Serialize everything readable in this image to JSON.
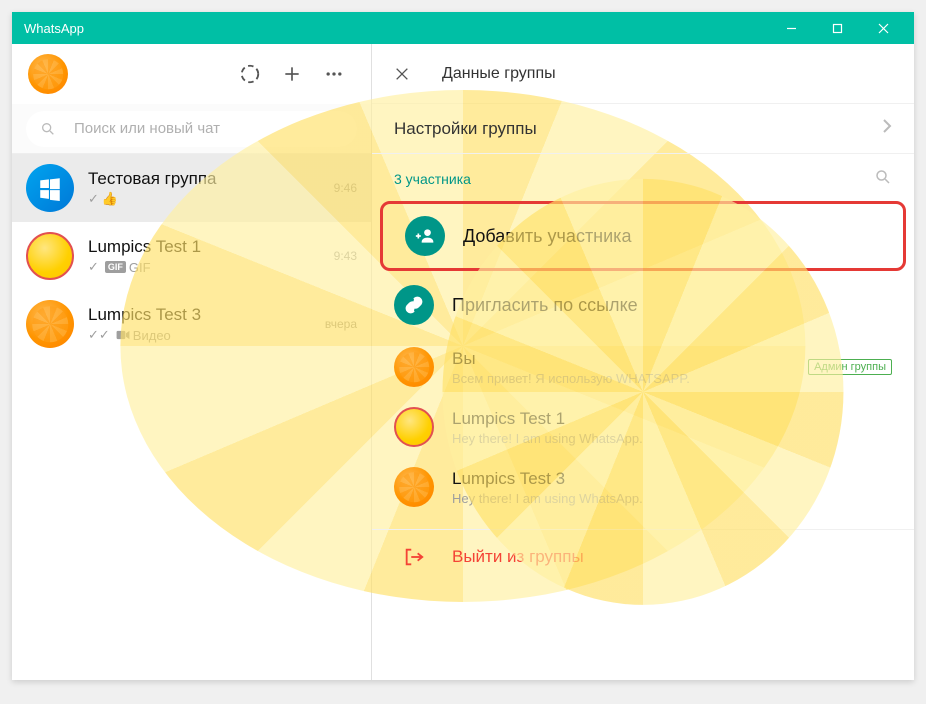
{
  "titlebar": {
    "title": "WhatsApp"
  },
  "search": {
    "placeholder": "Поиск или новый чат"
  },
  "chats": [
    {
      "title": "Тестовая группа",
      "sub_prefix": "✓",
      "sub_text": "👍",
      "time": "9:46",
      "avatar": "win",
      "active": true
    },
    {
      "title": "Lumpics Test 1",
      "sub_prefix": "✓",
      "sub_badge": "GIF",
      "sub_text": "GIF",
      "time": "9:43",
      "avatar": "lemon"
    },
    {
      "title": "Lumpics Test 3",
      "sub_prefix": "✓✓",
      "sub_icon": "video",
      "sub_text": "Видео",
      "time": "вчера",
      "avatar": "fruit"
    }
  ],
  "groupinfo": {
    "header": "Данные группы",
    "settings_label": "Настройки группы",
    "members_count_label": "3 участника",
    "add_member": "Добавить участника",
    "invite_link": "Пригласить по ссылке",
    "exit_group": "Выйти из группы",
    "admin_badge": "Админ группы"
  },
  "members": [
    {
      "name": "Вы",
      "status": "Всем привет! Я использую WHATSAPP.",
      "avatar": "fruit",
      "admin": true
    },
    {
      "name": "Lumpics Test 1",
      "status": "Hey there! I am using WhatsApp.",
      "avatar": "lemon"
    },
    {
      "name": "Lumpics Test 3",
      "status": "Hey there! I am using WhatsApp.",
      "avatar": "fruit"
    }
  ]
}
